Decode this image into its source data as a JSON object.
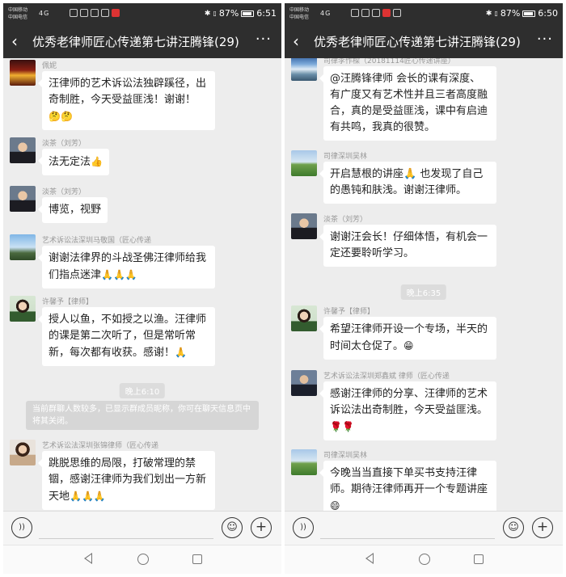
{
  "left": {
    "status": {
      "carrier1": "中国移动",
      "carrier2": "中国电信",
      "signal": "4G",
      "battery": "87%",
      "time": "6:51"
    },
    "title": "优秀老律师匠心传递第七讲汪腾锋(29)",
    "messages": [
      {
        "sender": "佩妮",
        "text": "汪律师的艺术诉讼法独辟蹊径，出奇制胜，今天受益匪浅！谢谢！",
        "emoji": "🤔🤔"
      },
      {
        "sender": "淡茶（刘芳）",
        "text": "法无定法",
        "emoji": "👍"
      },
      {
        "sender": "淡茶（刘芳）",
        "text": "博览，视野",
        "emoji": ""
      },
      {
        "sender": "艺术诉讼法深圳马敬国（匠心传递",
        "text": "谢谢法律界的斗战圣佛汪律师给我们指点迷津",
        "emoji": "🙏🙏🙏"
      },
      {
        "sender": "许馨予【律师】",
        "text": "授人以鱼，不如授之以渔。汪律师的课是第二次听了，但是常听常新，每次都有收获。感谢！",
        "emoji": "🙏"
      },
      {
        "sender": "艺术诉讼法深圳张锦律师（匠心传递",
        "text": "跳脱思维的局限，打破常理的禁锢，感谢汪律师为我们划出一方新天地",
        "emoji": "🙏🙏🙏"
      }
    ],
    "time_divider": "晚上6:10",
    "system_note": "当前群聊人数较多，已显示群成员昵称，你可在聊天信息页中将其关闭。"
  },
  "right": {
    "status": {
      "carrier1": "中国移动",
      "carrier2": "中国电信",
      "signal": "4G",
      "battery": "87%",
      "time": "6:50"
    },
    "title": "优秀老律师匠心传递第七讲汪腾锋(29)",
    "messages": [
      {
        "sender": "司律李作樑（20181114匠心传递讲座）",
        "text": "@汪腾锋律师 会长的课有深度、有广度又有艺术性并且三者高度融合，真的是受益匪浅，课中有启迪有共鸣，我真的很赞。",
        "emoji": ""
      },
      {
        "sender": "司律深圳吴林",
        "text": "开启慧根的讲座🙏 也发现了自己的愚钝和肤浅。谢谢汪律师。",
        "emoji": ""
      },
      {
        "sender": "淡茶（刘芳）",
        "text": "谢谢汪会长！仔细体悟，有机会一定还要聆听学习。",
        "emoji": ""
      },
      {
        "sender": "许馨予【律师】",
        "text": "希望汪律师开设一个专场，半天的时间太仓促了。",
        "emoji": "😁"
      },
      {
        "sender": "艺术诉讼法深圳郑鑫斌 律师（匠心传递",
        "text": "感谢汪律师的分享、汪律师的艺术诉讼法出奇制胜，今天受益匪浅。",
        "emoji": "🌹🌹"
      },
      {
        "sender": "司律深圳吴林",
        "text": "今晚当当直接下单买书支持汪律师。期待汪律师再开一个专题讲座",
        "emoji": "😄"
      }
    ],
    "time_divider": "晚上6:35"
  },
  "icons": {
    "back": "‹",
    "more": "···",
    "voice": "))",
    "emoji": "☺",
    "plus": "+"
  }
}
